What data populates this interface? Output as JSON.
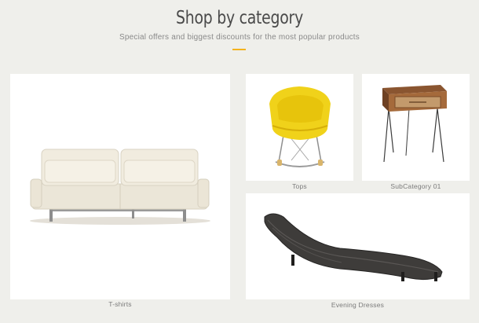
{
  "header": {
    "title": "Shop by category",
    "subtitle": "Special offers and biggest discounts for the most popular products",
    "accent_color": "#f4b31d"
  },
  "categories": [
    {
      "label": "T-shirts",
      "image": "sofa-image"
    },
    {
      "label": "Tops",
      "image": "yellow-chair-image"
    },
    {
      "label": "SubCategory 01",
      "image": "side-table-image"
    },
    {
      "label": "Evening Dresses",
      "image": "lounge-chair-image"
    }
  ]
}
